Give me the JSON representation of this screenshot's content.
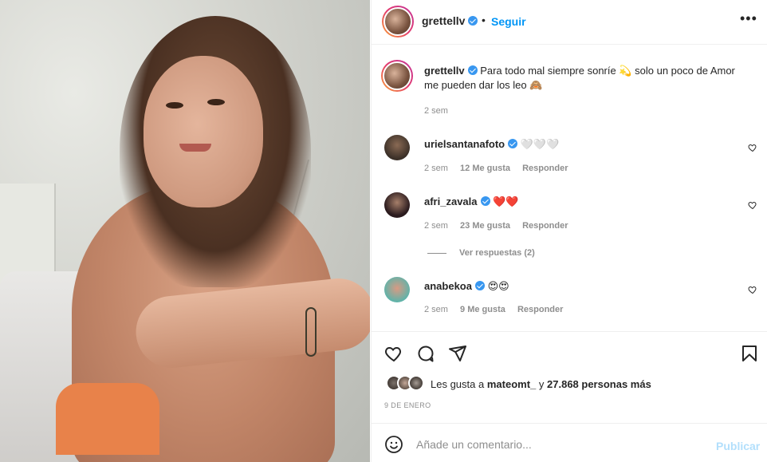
{
  "post": {
    "username": "grettellv",
    "follow_label": "Seguir",
    "separator": "•",
    "more_label": "•••"
  },
  "caption": {
    "username": "grettellv",
    "text": "Para todo mal siempre sonríe 💫 solo un poco de Amor me pueden dar los leo 🙈",
    "time": "2 sem"
  },
  "comments": [
    {
      "username": "urielsantanafoto",
      "text": "🤍🤍🤍",
      "time": "2 sem",
      "likes": "12 Me gusta",
      "reply": "Responder",
      "avatar_color": "#3a2f27"
    },
    {
      "username": "afri_zavala",
      "text": "❤️❤️",
      "time": "2 sem",
      "likes": "23 Me gusta",
      "reply": "Responder",
      "avatar_color": "#2b1b1e"
    },
    {
      "username": "anabekoa",
      "text": "😍😍",
      "time": "2 sem",
      "likes": "9 Me gusta",
      "reply": "Responder",
      "avatar_color": "#5fb3a9"
    }
  ],
  "replies": {
    "label": "Ver respuestas (2)"
  },
  "likes": {
    "prefix": "Les gusta a",
    "user": "mateomt_",
    "connector": "y",
    "count": "27.868 personas más"
  },
  "date": "9 DE ENERO",
  "composer": {
    "placeholder": "Añade un comentario...",
    "publish_label": "Publicar"
  },
  "colors": {
    "accent": "#0095f6",
    "verified": "#3897f0",
    "muted": "#8e8e8e",
    "publish_disabled": "#b2dffc"
  },
  "icons": [
    "verified-icon",
    "more-options-icon",
    "like-icon",
    "comment-icon",
    "share-icon",
    "save-icon",
    "emoji-icon"
  ]
}
